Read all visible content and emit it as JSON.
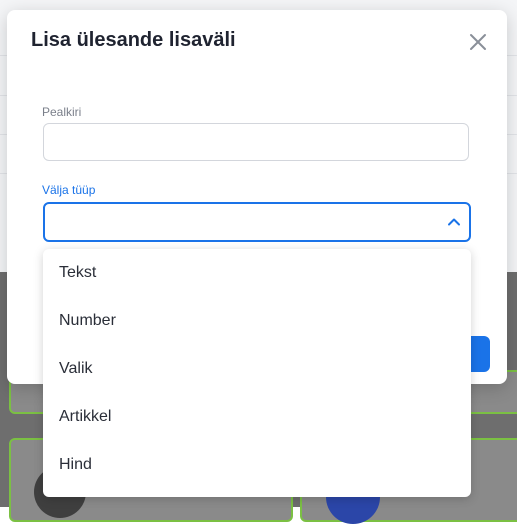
{
  "modal": {
    "title": "Lisa ülesande lisaväli",
    "close_icon": "close-icon",
    "title_field": {
      "label": "Pealkiri",
      "value": "",
      "placeholder": ""
    },
    "type_field": {
      "label": "Välja tüüp",
      "value": "",
      "chevron_icon": "chevron-up-icon",
      "expanded": true
    }
  },
  "dropdown": {
    "options": [
      "Tekst",
      "Number",
      "Valik",
      "Artikkel",
      "Hind"
    ]
  },
  "colors": {
    "accent": "#1a73e8",
    "title_text": "#1f2330",
    "label_muted": "#7a7f8a",
    "overlay": "#6e6e6e",
    "card_border": "#7bc043"
  }
}
